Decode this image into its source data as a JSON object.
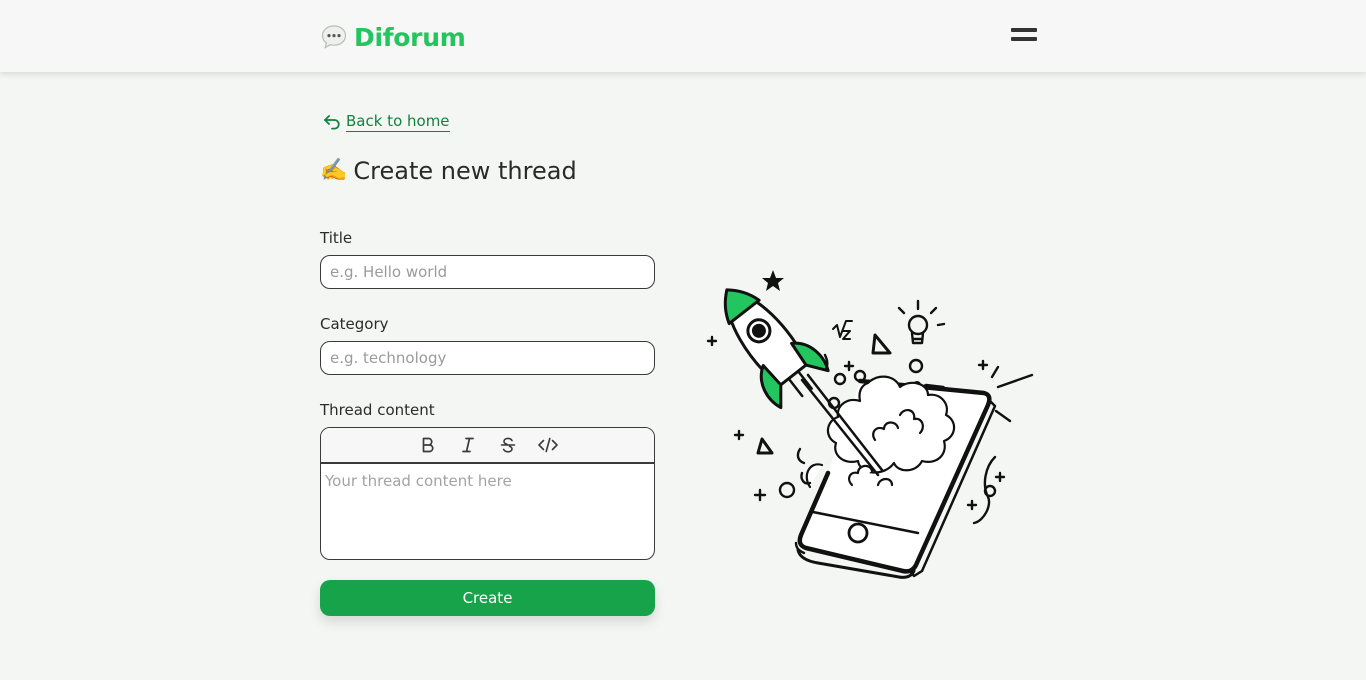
{
  "header": {
    "brand": "Diforum",
    "logo_icon": "speech-bubble-icon",
    "menu_icon": "hamburger-menu-icon",
    "brand_color": "#22c55e"
  },
  "nav": {
    "back_label": "Back to home",
    "back_icon": "undo-arrow-icon"
  },
  "page": {
    "title_emoji": "✍️",
    "title": "Create new thread"
  },
  "form": {
    "title_label": "Title",
    "title_placeholder": "e.g. Hello world",
    "category_label": "Category",
    "category_placeholder": "e.g. technology",
    "content_label": "Thread content",
    "content_placeholder": "Your thread content here",
    "toolbar": [
      "bold-icon",
      "italic-icon",
      "strikethrough-icon",
      "code-icon"
    ],
    "submit_label": "Create",
    "accent_color": "#16a34a"
  },
  "illustration": {
    "name": "rocket-launching-from-phone-illustration"
  }
}
